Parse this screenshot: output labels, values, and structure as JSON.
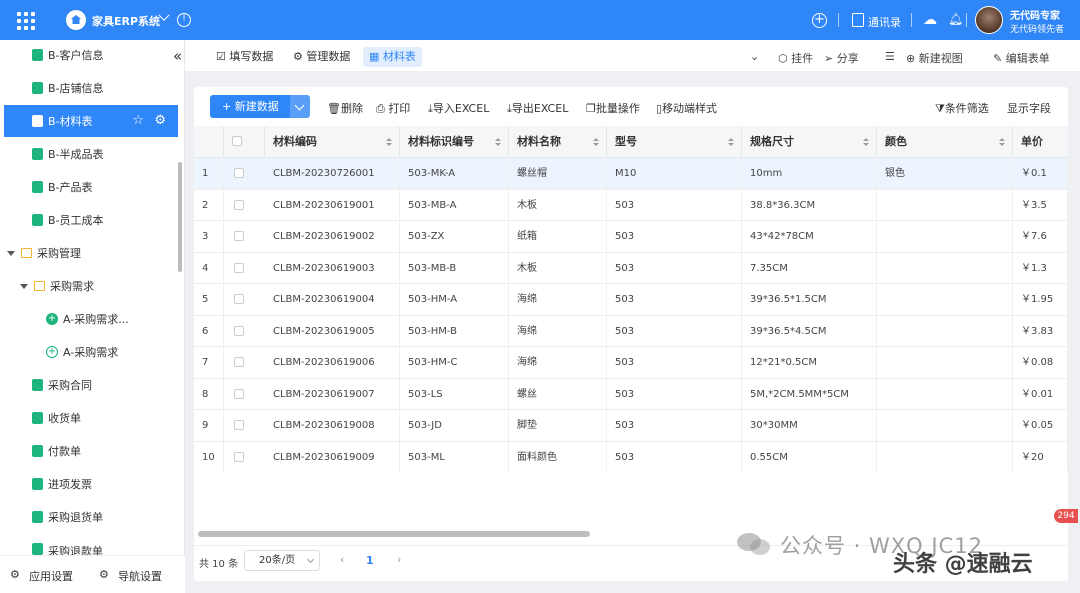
{
  "app": {
    "title": "家具ERP系统"
  },
  "topbar": {
    "contacts": "通讯录",
    "user_name": "无代码专家",
    "user_sub": "无代码领先者"
  },
  "sidebar": {
    "items": [
      {
        "label": "B-客户信息"
      },
      {
        "label": "B-店铺信息"
      },
      {
        "label": "B-材料表"
      },
      {
        "label": "B-半成品表"
      },
      {
        "label": "B-产品表"
      },
      {
        "label": "B-员工成本"
      },
      {
        "label": "采购管理"
      },
      {
        "label": "采购需求"
      },
      {
        "label": "A-采购需求..."
      },
      {
        "label": "A-采购需求"
      },
      {
        "label": "采购合同"
      },
      {
        "label": "收货单"
      },
      {
        "label": "付款单"
      },
      {
        "label": "进项发票"
      },
      {
        "label": "采购退货单"
      },
      {
        "label": "采购退款单"
      }
    ],
    "footer": {
      "app_settings": "应用设置",
      "nav_settings": "导航设置"
    }
  },
  "tabs": {
    "fill": "填写数据",
    "manage": "管理数据",
    "material": "材料表"
  },
  "tab_actions": {
    "plugin": "挂件",
    "share": "分享",
    "new_view": "新建视图",
    "edit_form": "编辑表单"
  },
  "toolbar": {
    "new": "+ 新建数据",
    "delete": "删除",
    "print": "打印",
    "import": "导入EXCEL",
    "export": "导出EXCEL",
    "batch": "批量操作",
    "mobile": "移动端样式",
    "filter": "条件筛选",
    "fields": "显示字段"
  },
  "table": {
    "columns": [
      "材料编码",
      "材料标识编号",
      "材料名称",
      "型号",
      "规格尺寸",
      "颜色",
      "单价"
    ],
    "rows": [
      [
        "1",
        "CLBM-20230726001",
        "503-MK-A",
        "螺丝帽",
        "M10",
        "10mm",
        "银色",
        "￥0.1"
      ],
      [
        "2",
        "CLBM-20230619001",
        "503-MB-A",
        "木板",
        "503",
        "38.8*36.3CM",
        "",
        "￥3.5"
      ],
      [
        "3",
        "CLBM-20230619002",
        "503-ZX",
        "纸箱",
        "503",
        "43*42*78CM",
        "",
        "￥7.6"
      ],
      [
        "4",
        "CLBM-20230619003",
        "503-MB-B",
        "木板",
        "503",
        "7.35CM",
        "",
        "￥1.3"
      ],
      [
        "5",
        "CLBM-20230619004",
        "503-HM-A",
        "海绵",
        "503",
        "39*36.5*1.5CM",
        "",
        "￥1.95"
      ],
      [
        "6",
        "CLBM-20230619005",
        "503-HM-B",
        "海绵",
        "503",
        "39*36.5*4.5CM",
        "",
        "￥3.83"
      ],
      [
        "7",
        "CLBM-20230619006",
        "503-HM-C",
        "海绵",
        "503",
        "12*21*0.5CM",
        "",
        "￥0.08"
      ],
      [
        "8",
        "CLBM-20230619007",
        "503-LS",
        "螺丝",
        "503",
        "5M,*2CM.5MM*5CM",
        "",
        "￥0.01"
      ],
      [
        "9",
        "CLBM-20230619008",
        "503-JD",
        "脚垫",
        "503",
        "30*30MM",
        "",
        "￥0.05"
      ],
      [
        "10",
        "CLBM-20230619009",
        "503-ML",
        "面料颜色",
        "503",
        "0.55CM",
        "",
        "￥20"
      ]
    ]
  },
  "pager": {
    "total": "共 10 条",
    "page_size": "20条/页",
    "current": "1",
    "prev": "‹",
    "next": "›"
  },
  "badge": "294",
  "watermark": {
    "left": "公众号 · WXQ JC12",
    "right": "头条 @速融云"
  },
  "colors": {
    "primary": "#2f86f6",
    "sidebar_active": "#2f86f6",
    "highlight_row": "#ecf4fe",
    "icon_green": "#1db47d",
    "folder": "#f4b232"
  }
}
